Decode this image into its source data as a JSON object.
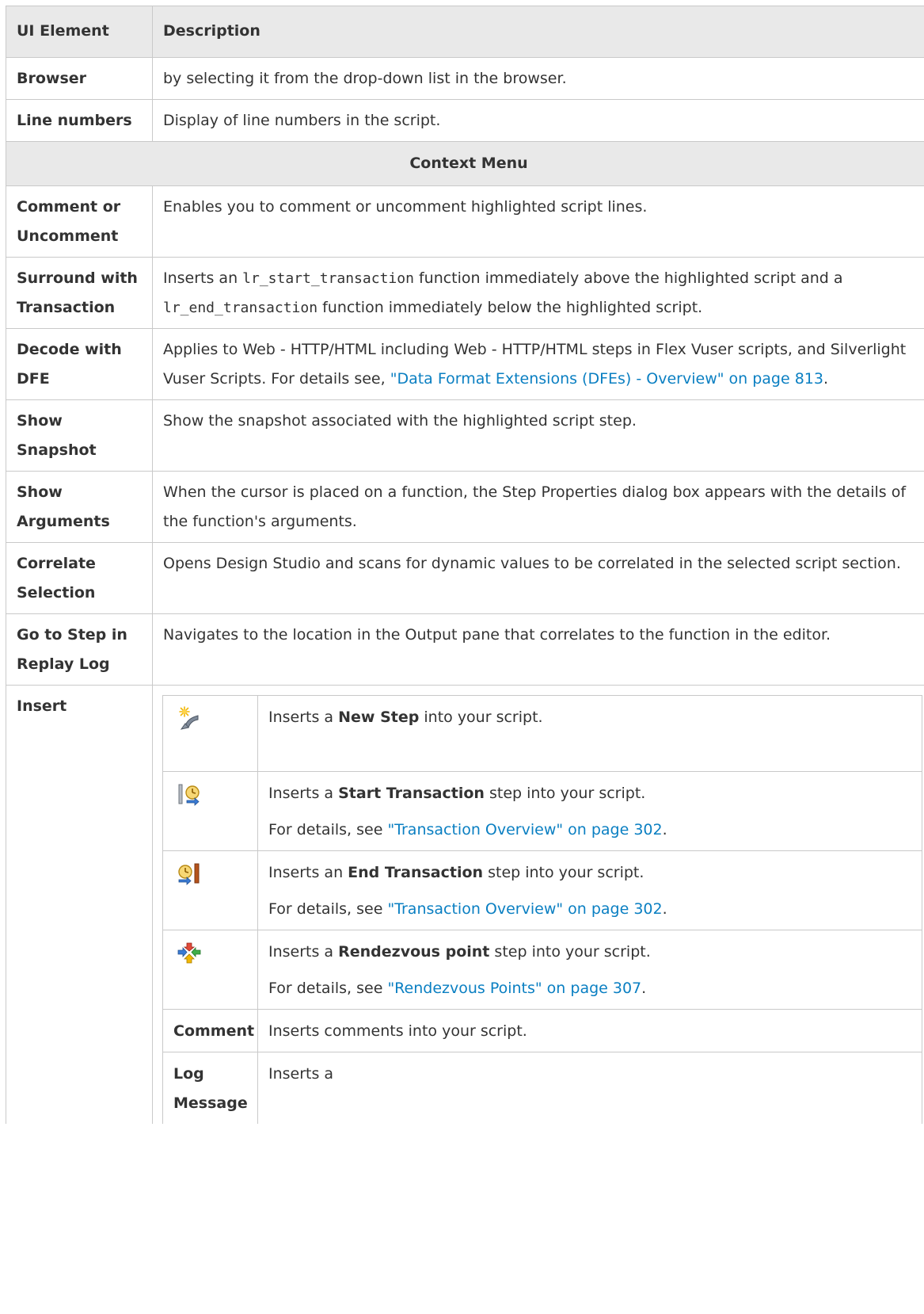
{
  "table": {
    "headers": {
      "ui_element": "UI Element",
      "description": "Description"
    },
    "rows": {
      "browser": {
        "name": "Browser",
        "desc": "by selecting it from the drop-down list in the browser."
      },
      "line_numbers": {
        "name": "Line numbers",
        "desc": "Display of line numbers in the script."
      }
    },
    "section_title": "Context Menu",
    "context": {
      "comment": {
        "name": "Comment or Uncomment",
        "desc": "Enables you to comment or uncomment highlighted script lines."
      },
      "surround": {
        "name": "Surround with Transaction",
        "desc_1": "Inserts an ",
        "code_1": "lr_start_transaction",
        "desc_2": " function immediately above the highlighted script and a ",
        "code_2": "lr_end_transaction",
        "desc_3": " function immediately below the highlighted script."
      },
      "decode": {
        "name": "Decode with DFE",
        "desc_1": "Applies to Web - HTTP/HTML including Web - HTTP/HTML steps in Flex Vuser scripts, and Silverlight Vuser Scripts. For details see, ",
        "link": "\"Data Format Extensions (DFEs) - Overview\" on page 813",
        "desc_2": "."
      },
      "show_snapshot": {
        "name": "Show Snapshot",
        "desc": "Show the snapshot associated with the highlighted script step."
      },
      "show_arguments": {
        "name": "Show Arguments",
        "desc": "When the cursor is placed on a function, the Step Properties dialog box appears with the details of the function's arguments."
      },
      "correlate": {
        "name": "Correlate Selection",
        "desc": "Opens Design Studio and scans for dynamic values to be correlated in the selected script section."
      },
      "goto_step": {
        "name": "Go to Step in Replay Log",
        "desc": "Navigates to the location in the Output pane that correlates to the function in the editor."
      },
      "insert": {
        "name": "Insert",
        "items": {
          "new_step": {
            "icon": "new-step-icon",
            "pre": "Inserts a ",
            "bold": "New Step",
            "post": " into your script."
          },
          "start_tx": {
            "icon": "start-transaction-icon",
            "pre": "Inserts a ",
            "bold": "Start Transaction",
            "post": " step into your script.",
            "details_pre": "For details, see ",
            "link": "\"Transaction Overview\" on page 302",
            "details_post": "."
          },
          "end_tx": {
            "icon": "end-transaction-icon",
            "pre": "Inserts an ",
            "bold": "End Transaction",
            "post": " step into your script.",
            "details_pre": "For details, see ",
            "link": "\"Transaction Overview\" on page 302",
            "details_post": "."
          },
          "rendezvous": {
            "icon": "rendezvous-icon",
            "pre": "Inserts a ",
            "bold": "Rendezvous point",
            "post": " step into your script.",
            "details_pre": "For details, see ",
            "link": "\"Rendezvous Points\" on page 307",
            "details_post": "."
          },
          "comment": {
            "name": "Comment",
            "desc": "Inserts comments into your script."
          },
          "log_message": {
            "name": "Log Message",
            "desc": "Inserts a"
          }
        }
      }
    }
  },
  "colors": {
    "header_bg": "#e9e9e9",
    "border": "#c9c9c9",
    "text": "#333333",
    "link": "#0a7fc2"
  }
}
